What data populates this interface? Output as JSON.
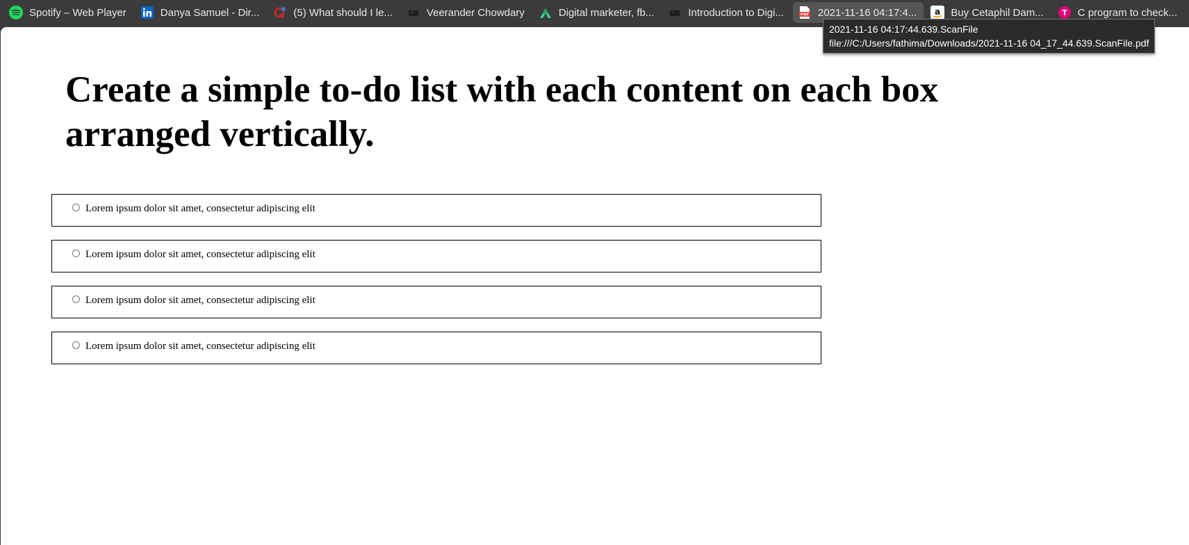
{
  "bookmarks": [
    {
      "label": "Spotify – Web Player",
      "icon": "spotify-icon",
      "color": "#1ed760"
    },
    {
      "label": "Danya Samuel - Dir...",
      "icon": "linkedin-icon",
      "color": "#0a66c2"
    },
    {
      "label": "(5) What should I le...",
      "icon": "quora-icon",
      "color": "#b92b27"
    },
    {
      "label": "Veerander Chowdary",
      "icon": "page-icon",
      "color": "#222222"
    },
    {
      "label": "Digital marketer, fb...",
      "icon": "upwork-icon",
      "color": "#3ccf8e"
    },
    {
      "label": "Introduction to Digi...",
      "icon": "page-icon",
      "color": "#222222"
    },
    {
      "label": "2021-11-16 04:17:4...",
      "icon": "pdf-icon",
      "color": "#e53935"
    },
    {
      "label": "Buy Cetaphil Dam...",
      "icon": "amazon-icon",
      "color": "#ffffff"
    },
    {
      "label": "C program to check...",
      "icon": "tmobile-icon",
      "color": "#e20074"
    }
  ],
  "tooltip": {
    "title": "2021-11-16 04:17:44.639.ScanFile",
    "path": "file:///C:/Users/fathima/Downloads/2021-11-16 04_17_44.639.ScanFile.pdf"
  },
  "page": {
    "heading": "Create a simple to-do list with each content on each box arranged vertically.",
    "todos": [
      {
        "text": "Lorem ipsum dolor sit amet, consectetur adipiscing elit",
        "checked": false
      },
      {
        "text": "Lorem ipsum dolor sit amet, consectetur adipiscing elit",
        "checked": false
      },
      {
        "text": "Lorem ipsum dolor sit amet, consectetur adipiscing elit",
        "checked": false
      },
      {
        "text": "Lorem ipsum dolor sit amet, consectetur adipiscing elit",
        "checked": false
      }
    ]
  }
}
